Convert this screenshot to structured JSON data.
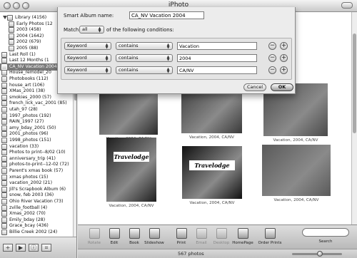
{
  "window": {
    "title": "iPhoto"
  },
  "sidebar": {
    "items": [
      {
        "label": "Library (4156)"
      },
      {
        "label": "Early Photos (12"
      },
      {
        "label": "2003 (458)"
      },
      {
        "label": "2004 (1642)"
      },
      {
        "label": "2002 (679)"
      },
      {
        "label": "2005 (88)"
      },
      {
        "label": "Last Roll (1)"
      },
      {
        "label": "Last 12 Months (1"
      },
      {
        "label": "CA_NV Vacation 2004"
      },
      {
        "label": "House_remodel_20"
      },
      {
        "label": "Photobooks (112)"
      },
      {
        "label": "house_art (106)"
      },
      {
        "label": "XMas_2001 (38)"
      },
      {
        "label": "smokies_2000 (57)"
      },
      {
        "label": "french_lick_vac_2001 (85)"
      },
      {
        "label": "utah_97 (28)"
      },
      {
        "label": "1997_photos (192)"
      },
      {
        "label": "RAIN_1997 (27)"
      },
      {
        "label": "amy_bday_2001 (50)"
      },
      {
        "label": "2001_photos (96)"
      },
      {
        "label": "1998_photos (151)"
      },
      {
        "label": "vacation (33)"
      },
      {
        "label": "Photos to print--8/02 (10)"
      },
      {
        "label": "anniversary_trip (41)"
      },
      {
        "label": "photos-to-print--12-02 (72)"
      },
      {
        "label": "Parent's xmas book (57)"
      },
      {
        "label": "xmas photos (15)"
      },
      {
        "label": "vacation_2002 (21)"
      },
      {
        "label": "Jill's Scrapbook Album (6)"
      },
      {
        "label": "snow, feb 2003 (36)"
      },
      {
        "label": "Ohio River Vacation (73)"
      },
      {
        "label": "zville_football (4)"
      },
      {
        "label": "Xmas_2002 (70)"
      },
      {
        "label": "Emily_bday (28)"
      },
      {
        "label": "Grace_bcay (436)"
      },
      {
        "label": "Billie Creek 2002 (24)"
      }
    ],
    "buttons": {
      "add": "+",
      "play": "▶",
      "info": "ⓘ",
      "calendar": "⌗"
    }
  },
  "sheet": {
    "name_label": "Smart Album name:",
    "name_value": "CA_NV Vacation 2004",
    "match_label": "Match",
    "match_value": "all",
    "match_suffix": "of the following conditions:",
    "conditions": [
      {
        "field": "Keyword",
        "op": "contains",
        "value": "Vacation"
      },
      {
        "field": "Keyword",
        "op": "contains",
        "value": "2004"
      },
      {
        "field": "Keyword",
        "op": "contains",
        "value": "CA/NV"
      }
    ],
    "remove_symbol": "−",
    "add_symbol": "+",
    "cancel_label": "Cancel",
    "ok_label": "OK"
  },
  "photos": [
    {
      "caption": "Vacation, 2004, CA/NV"
    },
    {
      "caption": "Vacation, 2004, CA/NV"
    },
    {
      "caption": "Vacation, 2004, CA/NV"
    },
    {
      "caption": "Vacation, 2004, CA/NV",
      "sign": "Travelodge"
    },
    {
      "caption": "Vacation, 2004, CA/NV",
      "sign": "Travelodge"
    },
    {
      "caption": "Vacation, 2004, CA/NV"
    }
  ],
  "toolbar": {
    "buttons": [
      {
        "label": "Rotate"
      },
      {
        "label": "Edit"
      },
      {
        "label": "Book"
      },
      {
        "label": "Slideshow"
      },
      {
        "label": "Print"
      },
      {
        "label": "Email"
      },
      {
        "label": "Desktop"
      },
      {
        "label": "HomePage"
      },
      {
        "label": "Order Prints"
      }
    ],
    "search_label": "Search"
  },
  "status": {
    "photo_count": "567 photos",
    "zoom_level": 0.55
  }
}
